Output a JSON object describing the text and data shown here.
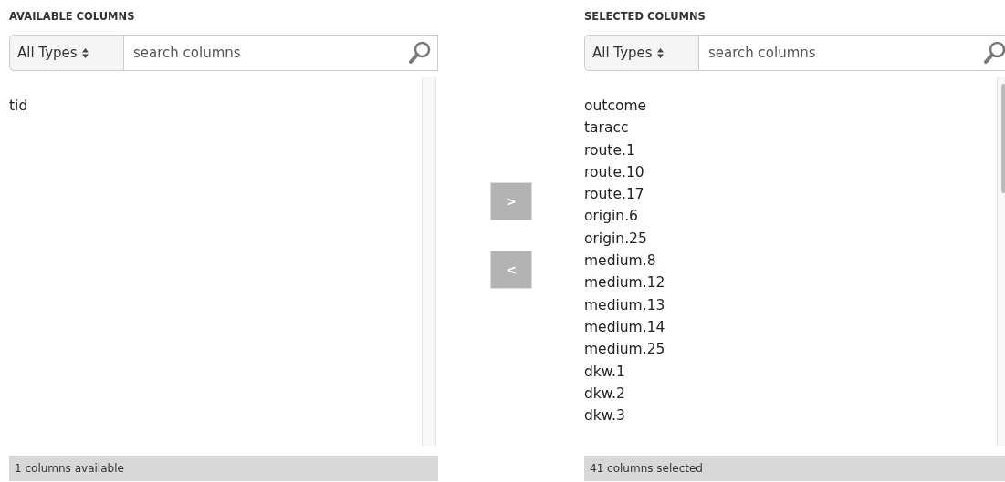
{
  "panels": [
    {
      "heading": "AVAILABLE COLUMNS",
      "type_filter": "All Types",
      "search": {
        "placeholder": "search columns"
      },
      "items": [
        "tid"
      ],
      "footer": "1 columns available"
    },
    {
      "heading": "SELECTED COLUMNS",
      "type_filter": "All Types",
      "search": {
        "placeholder": "search columns"
      },
      "items": [
        "outcome",
        "taracc",
        "route.1",
        "route.10",
        "route.17",
        "origin.6",
        "origin.25",
        "medium.8",
        "medium.12",
        "medium.13",
        "medium.14",
        "medium.25",
        "dkw.1",
        "dkw.2",
        "dkw.3"
      ],
      "footer": "41 columns selected"
    }
  ],
  "move_buttons": [
    ">",
    "<"
  ]
}
